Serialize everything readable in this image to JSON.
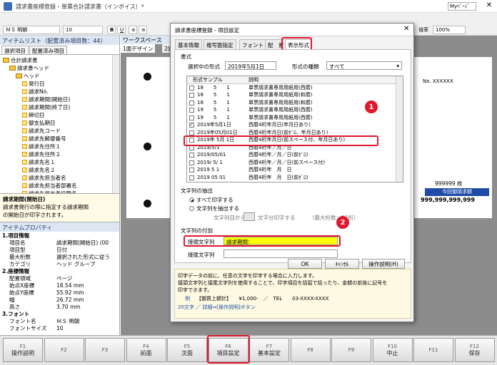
{
  "window": {
    "title": "請求書座標登録 - 単票合計請求書（インボイス）*",
    "mypage": "Myﾍﾟｰｼﾞ"
  },
  "toolbar": {
    "font": "ＭＳ 明朝",
    "size": "10",
    "bold": "B",
    "underline": "U",
    "zoom_label": "倍率",
    "zoom": "100%"
  },
  "left": {
    "header": "アイテムリスト（配置済み項目数：44）",
    "tabs": [
      "選択項目",
      "配置済み項目"
    ],
    "tree": [
      {
        "label": "合計請求書",
        "level": 0,
        "type": "folder"
      },
      {
        "label": "請求書ヘッド",
        "level": 1,
        "type": "folder"
      },
      {
        "label": "ヘッド",
        "level": 2,
        "type": "folder"
      },
      {
        "label": "発行日",
        "level": 3,
        "type": "item"
      },
      {
        "label": "請求No.",
        "level": 3,
        "type": "item"
      },
      {
        "label": "請求期間(開始日)",
        "level": 3,
        "type": "item"
      },
      {
        "label": "請求期間(終了日)",
        "level": 3,
        "type": "item"
      },
      {
        "label": "締切日",
        "level": 3,
        "type": "item"
      },
      {
        "label": "御支払期日",
        "level": 3,
        "type": "item"
      },
      {
        "label": "請求先コード",
        "level": 3,
        "type": "item"
      },
      {
        "label": "請求先郵便番号",
        "level": 3,
        "type": "item"
      },
      {
        "label": "請求先住所１",
        "level": 3,
        "type": "item"
      },
      {
        "label": "請求先住所２",
        "level": 3,
        "type": "item"
      },
      {
        "label": "請求先名１",
        "level": 3,
        "type": "item"
      },
      {
        "label": "請求先名２",
        "level": 3,
        "type": "item"
      },
      {
        "label": "請求先担当者名",
        "level": 3,
        "type": "item"
      },
      {
        "label": "請求先担当者部署名",
        "level": 3,
        "type": "item"
      },
      {
        "label": "請求先担当者役職名",
        "level": 3,
        "type": "item"
      }
    ],
    "desc_title": "請求期間(開始日)",
    "desc_text": "請求書発行の際に指定する請求期間",
    "desc_text2": "の開始日が印字されます。",
    "prop_header": "アイテムプロパティ",
    "props": [
      {
        "k": "1.項目情報",
        "v": "",
        "head": true
      },
      {
        "k": "項目名",
        "v": "請求期間(開始日) (00"
      },
      {
        "k": "項目型",
        "v": "日付"
      },
      {
        "k": "最大桁数",
        "v": "選択された形式に従う"
      },
      {
        "k": "カテゴリ",
        "v": "ヘッド グループ"
      },
      {
        "k": "2.座標情報",
        "v": "",
        "head": true
      },
      {
        "k": "配置領域",
        "v": "ページ"
      },
      {
        "k": "始点X座標",
        "v": "18.54 mm"
      },
      {
        "k": "始点Y座標",
        "v": "55.92 mm"
      },
      {
        "k": "幅",
        "v": "26.72 mm"
      },
      {
        "k": "高さ",
        "v": "3.70 mm"
      },
      {
        "k": "3.フォント",
        "v": "",
        "head": true
      },
      {
        "k": "フォント名",
        "v": "ＭＳ 明朝"
      },
      {
        "k": "フォントサイズ",
        "v": "10"
      }
    ]
  },
  "workspace": {
    "tab": "ワークスペース",
    "sub_tabs": [
      "1面デザイン",
      "2面"
    ],
    "doc_no": "No. XXXXXX",
    "amount1": "999999 枚",
    "header_cell": "今回御請求額",
    "amount2": "999,999,999,999"
  },
  "dialog": {
    "title": "請求書座標登録 - 項目設定",
    "tabs": [
      "基本情報",
      "複写面指定",
      "フォント",
      "配　置",
      "表示形式"
    ],
    "format_section": "書式",
    "selected_label": "選択中の形式",
    "selected_value": "2019年5月1日",
    "kind_label": "形式の種類",
    "kind_value": "すべて",
    "col_sample": "形式サンプル",
    "col_desc": "説明",
    "list": [
      {
        "sample": "18　　5　　1",
        "desc": "単票請求書専用用紙用(西暦)",
        "checked": false
      },
      {
        "sample": "18　　5　　1",
        "desc": "単票請求書専用用紙用(和暦)",
        "checked": false
      },
      {
        "sample": "18　　5　　1",
        "desc": "単票請求書専用用紙用(和暦)",
        "checked": false
      },
      {
        "sample": "19　　5　　1",
        "desc": "単票請求書専用用紙用(西暦)",
        "checked": false
      },
      {
        "sample": "19　　5　　1",
        "desc": "単票請求書専用用紙用(西暦)",
        "checked": false
      },
      {
        "sample": "2019年5月1日",
        "desc": "西暦4桁年月日(年月日あり)",
        "checked": true
      },
      {
        "sample": "2019年05月01日",
        "desc": "西暦4桁年月日(前ｾﾞﾛ、年月日あり)",
        "checked": false
      },
      {
        "sample": "2019年 5月 1日",
        "desc": "西暦4桁年月日(前スペース付、年月日あり)",
        "checked": false
      },
      {
        "sample": "2019/5/1",
        "desc": "西暦4桁年／月／日",
        "checked": false
      },
      {
        "sample": "2019/05/01",
        "desc": "西暦4桁年／月／日(前ｾﾞﾛ)",
        "checked": false
      },
      {
        "sample": "2019/ 5/ 1",
        "desc": "西暦4桁年／月／日(前スペース付)",
        "checked": false
      },
      {
        "sample": "2019 5 1",
        "desc": "西暦4桁年　月　日",
        "checked": false
      },
      {
        "sample": "2019 05 01",
        "desc": "西暦4桁年　月　日(前ｾﾞﾛ)",
        "checked": false
      },
      {
        "sample": "2019　5　1",
        "desc": "西暦4桁年　月　日(前スペース付)",
        "checked": false
      }
    ],
    "extract_section": "文字列の抽出",
    "radio_all": "すべて印字する",
    "radio_extract": "文字列を抽出する",
    "from_label": "文字列目から",
    "to_label": "文字分印字する",
    "max_label": "（最大桁数：11桁）",
    "add_section": "文字列の付加",
    "prefix_label": "接頭文字列",
    "prefix_value": "請求期間：",
    "suffix_label": "接尾文字列",
    "suffix_value": "",
    "ok": "OK",
    "cancel": "ｷｬﾝｾﾙ",
    "help": "操作説明(H)",
    "info1": "印字データの前に、任意の文字を印字する場合に入力します。",
    "info2": "接頭文字列と接尾文字列を使用することで、印字項目を括弧で括ったり、金額の前後に記号を",
    "info3": "印字できます。",
    "info_ex_label": "例",
    "info_ex": "【御買上額計】　　¥1,000-　／　TEL　　03-XXXX-XXXX",
    "info_link": "20文字 ／ 詳細⇒[操作説明]ボタン"
  },
  "badges": [
    "1",
    "2"
  ],
  "fkeys": [
    {
      "key": "F1",
      "label": "操作説明"
    },
    {
      "key": "F2",
      "label": ""
    },
    {
      "key": "F3",
      "label": ""
    },
    {
      "key": "F4",
      "label": "前面"
    },
    {
      "key": "F5",
      "label": "次面"
    },
    {
      "key": "F6",
      "label": "項目設定"
    },
    {
      "key": "F7",
      "label": "基本設定"
    },
    {
      "key": "F8",
      "label": ""
    },
    {
      "key": "F9",
      "label": ""
    },
    {
      "key": "F10",
      "label": "中止"
    },
    {
      "key": "F11",
      "label": ""
    },
    {
      "key": "F12",
      "label": "保存"
    }
  ],
  "colors": {
    "highlight": "#ffff00",
    "annotation": "#e0182d",
    "pane_head": "#dde6f3"
  }
}
